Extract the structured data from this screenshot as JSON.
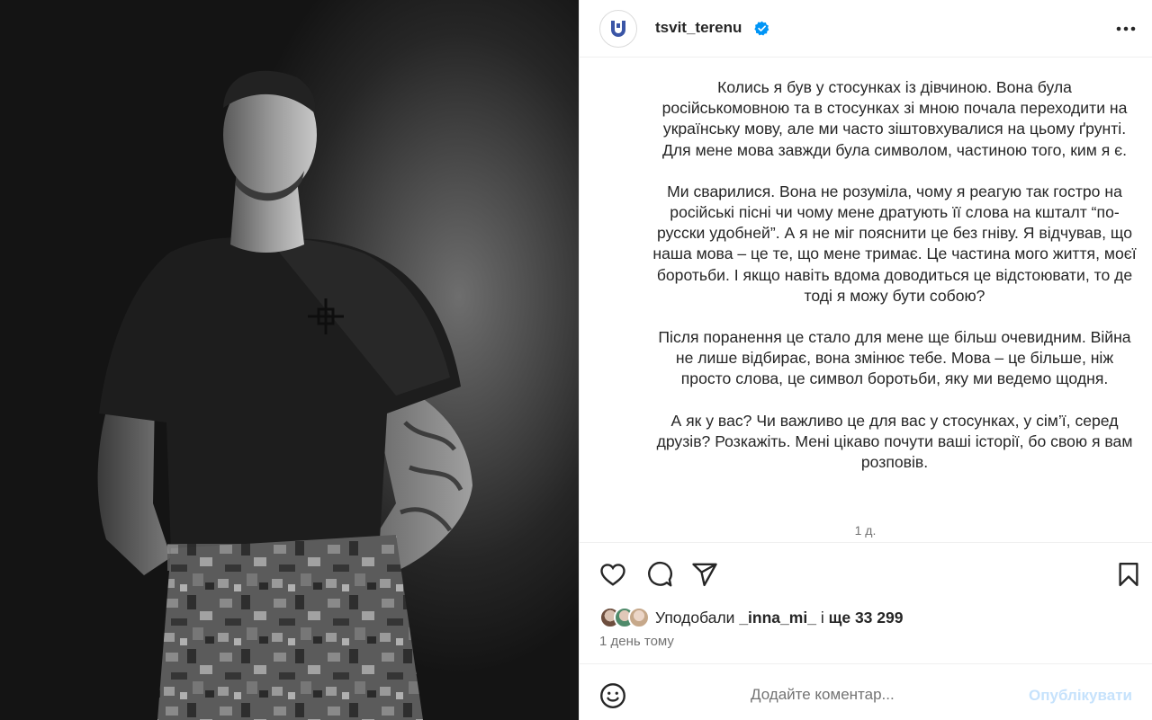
{
  "post": {
    "username": "tsvit_terenu",
    "caption": [
      "Колись я був у стосунках із дівчиною. Вона була російськомовною та в стосунках зі мною почала переходити на українську мову, але ми часто зіштовхувалися на цьому ґрунті. Для мене мова завжди була символом, частиною того, ким я є.",
      "Ми сварилися. Вона не розуміла, чому я реагую так гостро на російські пісні чи чому мене дратують її слова на кшталт “по-русски удобней”. А я не міг пояснити це без гніву. Я відчував, що наша мова – це те, що мене тримає. Це частина мого життя, моєї боротьби. І якщо навіть вдома доводиться це відстоювати, то де тоді я можу бути собою?",
      "Після поранення це стало для мене ще більш очевидним. Війна не лише відбирає, вона змінює тебе. Мова – це більше, ніж просто слова, це символ боротьби, яку ми ведемо щодня.",
      "А як у вас? Чи важливо це для вас у стосунках, у сім’ї, серед друзів? Розкажіть. Мені цікаво почути ваші історії, бо свою я вам розповів."
    ],
    "caption_age": "1 д.",
    "likes_prefix": "Уподобали",
    "likes_user": "_inna_mi_",
    "likes_middle": "і",
    "likes_count": "ще 33 299",
    "date": "1 день тому"
  },
  "comment": {
    "placeholder": "Додайте коментар...",
    "publish_label": "Опублікувати"
  },
  "icons": {
    "avatar": "brand-logo-icon",
    "verified": "verified-badge-icon",
    "more": "more-options-icon",
    "like": "heart-icon",
    "comment": "comment-icon",
    "share": "send-icon",
    "save": "bookmark-icon",
    "emoji": "emoji-icon"
  },
  "colors": {
    "verified_blue": "#0095f6",
    "publish_disabled": "#c6e2fc",
    "secondary_text": "#737373",
    "logo_blue": "#3a55a6"
  }
}
